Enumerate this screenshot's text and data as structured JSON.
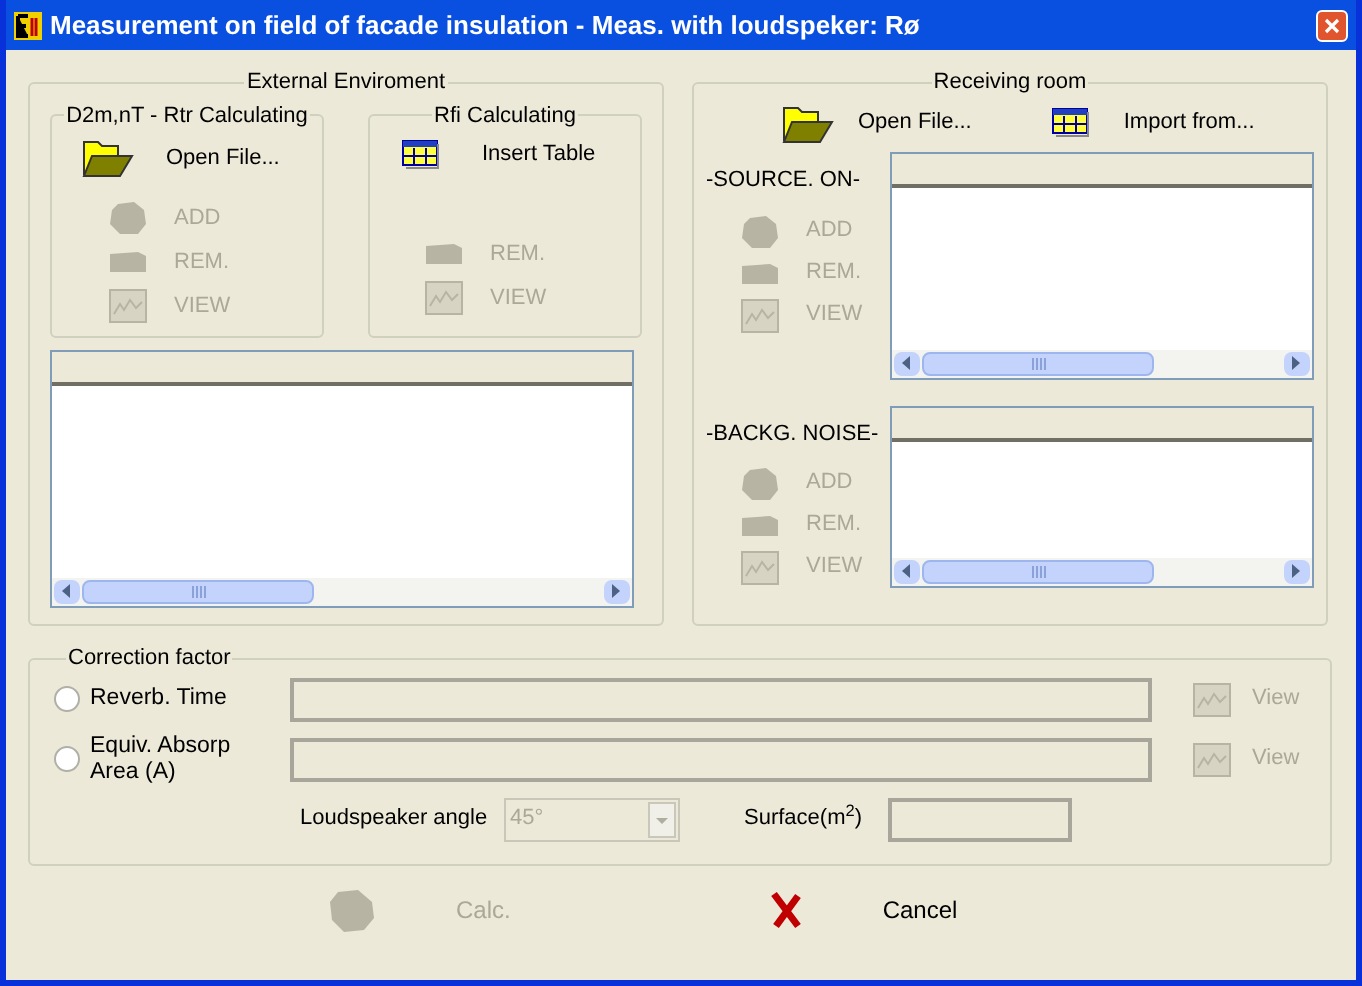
{
  "window": {
    "title": "Measurement on field of facade insulation - Meas. with loudspeker: Rø"
  },
  "external": {
    "title": "External Enviroment",
    "d2m": {
      "title": "D2m,nT - Rtr Calculating",
      "open_file": {
        "label": "Open File...",
        "disabled": false
      },
      "buttons": [
        {
          "kind": "add",
          "label": "ADD",
          "disabled": true
        },
        {
          "kind": "rem",
          "label": "REM.",
          "disabled": true
        },
        {
          "kind": "view",
          "label": "VIEW",
          "disabled": true
        }
      ]
    },
    "rfi": {
      "title": "Rfi Calculating",
      "insert_table": {
        "label": "Insert Table",
        "disabled": false
      },
      "buttons": [
        {
          "kind": "rem",
          "label": "REM.",
          "disabled": true
        },
        {
          "kind": "view",
          "label": "VIEW",
          "disabled": true
        }
      ]
    }
  },
  "receiving": {
    "title": "Receiving room",
    "open_file": {
      "label": "Open File...",
      "disabled": false
    },
    "import_from": {
      "label": "Import from...",
      "disabled": false
    },
    "sections": [
      {
        "label": "-SOURCE. ON-",
        "buttons": [
          {
            "kind": "add",
            "label": "ADD",
            "disabled": true
          },
          {
            "kind": "rem",
            "label": "REM.",
            "disabled": true
          },
          {
            "kind": "view",
            "label": "VIEW",
            "disabled": true
          }
        ]
      },
      {
        "label": "-BACKG. NOISE-",
        "buttons": [
          {
            "kind": "add",
            "label": "ADD",
            "disabled": true
          },
          {
            "kind": "rem",
            "label": "REM.",
            "disabled": true
          },
          {
            "kind": "view",
            "label": "VIEW",
            "disabled": true
          }
        ]
      }
    ]
  },
  "correction": {
    "title": "Correction factor",
    "options": [
      {
        "label": "Reverb. Time",
        "selected": false,
        "view": {
          "label": "View",
          "disabled": true
        }
      },
      {
        "label": "Equiv. Absorp Area (A)",
        "selected": false,
        "view": {
          "label": "View",
          "disabled": true
        }
      }
    ],
    "loudspeaker_angle": {
      "label": "Loudspeaker angle",
      "value": "45°",
      "disabled": true
    },
    "surface": {
      "label": "Surface(m$^{2}$)"
    }
  },
  "buttons": [
    {
      "kind": "calc",
      "label": "Calc.",
      "disabled": true
    },
    {
      "kind": "cancel",
      "label": "Cancel",
      "disabled": false
    }
  ]
}
